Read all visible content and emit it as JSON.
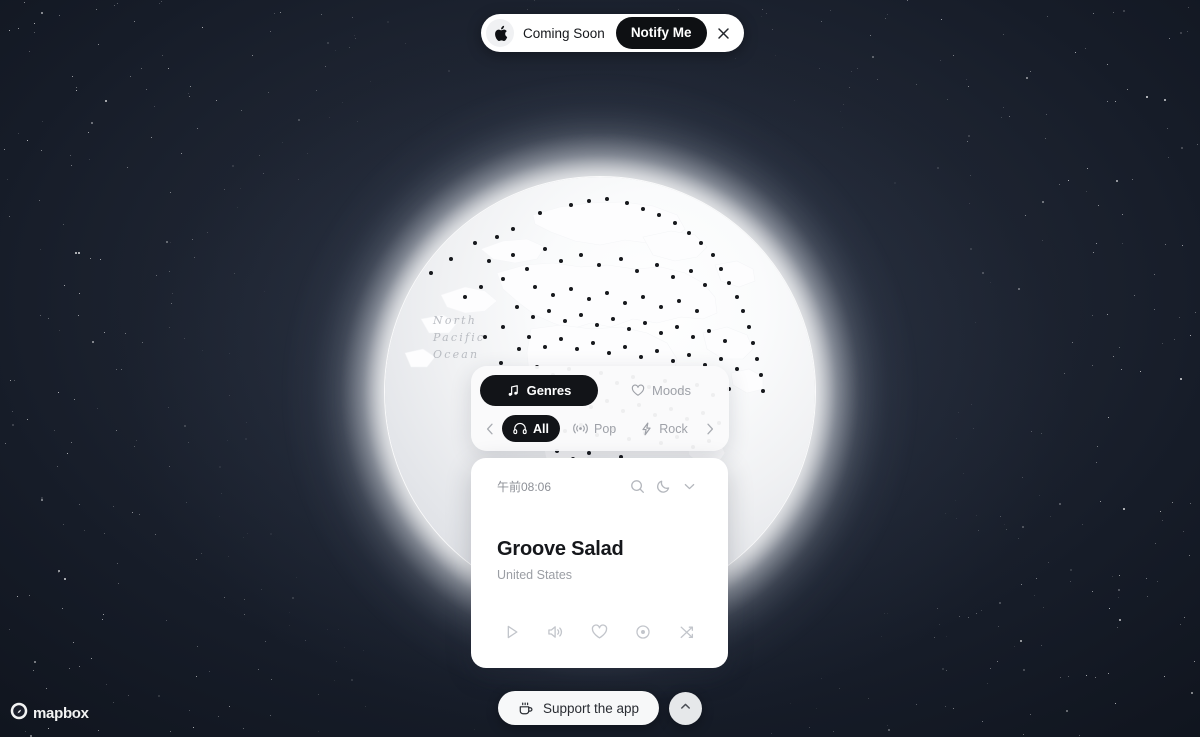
{
  "banner": {
    "icon": "apple-icon",
    "text": "Coming Soon",
    "notify_label": "Notify Me",
    "close_label": "×"
  },
  "globe": {
    "ocean_label": "North\nPacific\nOcean",
    "station_dot_color": "#17191d",
    "glow_color": "#ffffff"
  },
  "genres_panel": {
    "tabs": [
      {
        "label": "Genres",
        "icon": "music-note-icon",
        "active": true
      },
      {
        "label": "Moods",
        "icon": "heart-icon",
        "active": false
      }
    ],
    "prev_label": "‹",
    "next_label": "›",
    "chips": [
      {
        "label": "All",
        "icon": "headphones-icon",
        "active": true
      },
      {
        "label": "Pop",
        "icon": "broadcast-icon",
        "active": false
      },
      {
        "label": "Rock",
        "icon": "lightning-icon",
        "active": false
      }
    ]
  },
  "player": {
    "local_time": "午前08:06",
    "topbar_icons": [
      "search-icon",
      "moon-icon",
      "chevron-down-icon"
    ],
    "station_name": "Groove Salad",
    "station_country": "United States",
    "controls": [
      "play-icon",
      "volume-icon",
      "heart-icon",
      "location-pin-icon",
      "shuffle-icon"
    ]
  },
  "bottom_bar": {
    "support_label": "Support the app",
    "support_icon": "coffee-cup-icon",
    "expand_icon": "chevron-up-icon"
  },
  "attribution": {
    "wordmark": "mapbox",
    "icon": "mapbox-icon"
  },
  "colors": {
    "background": "#0c1018",
    "accent_dark": "#121418",
    "card": "#ffffff",
    "muted_text": "#9ea1a8"
  }
}
